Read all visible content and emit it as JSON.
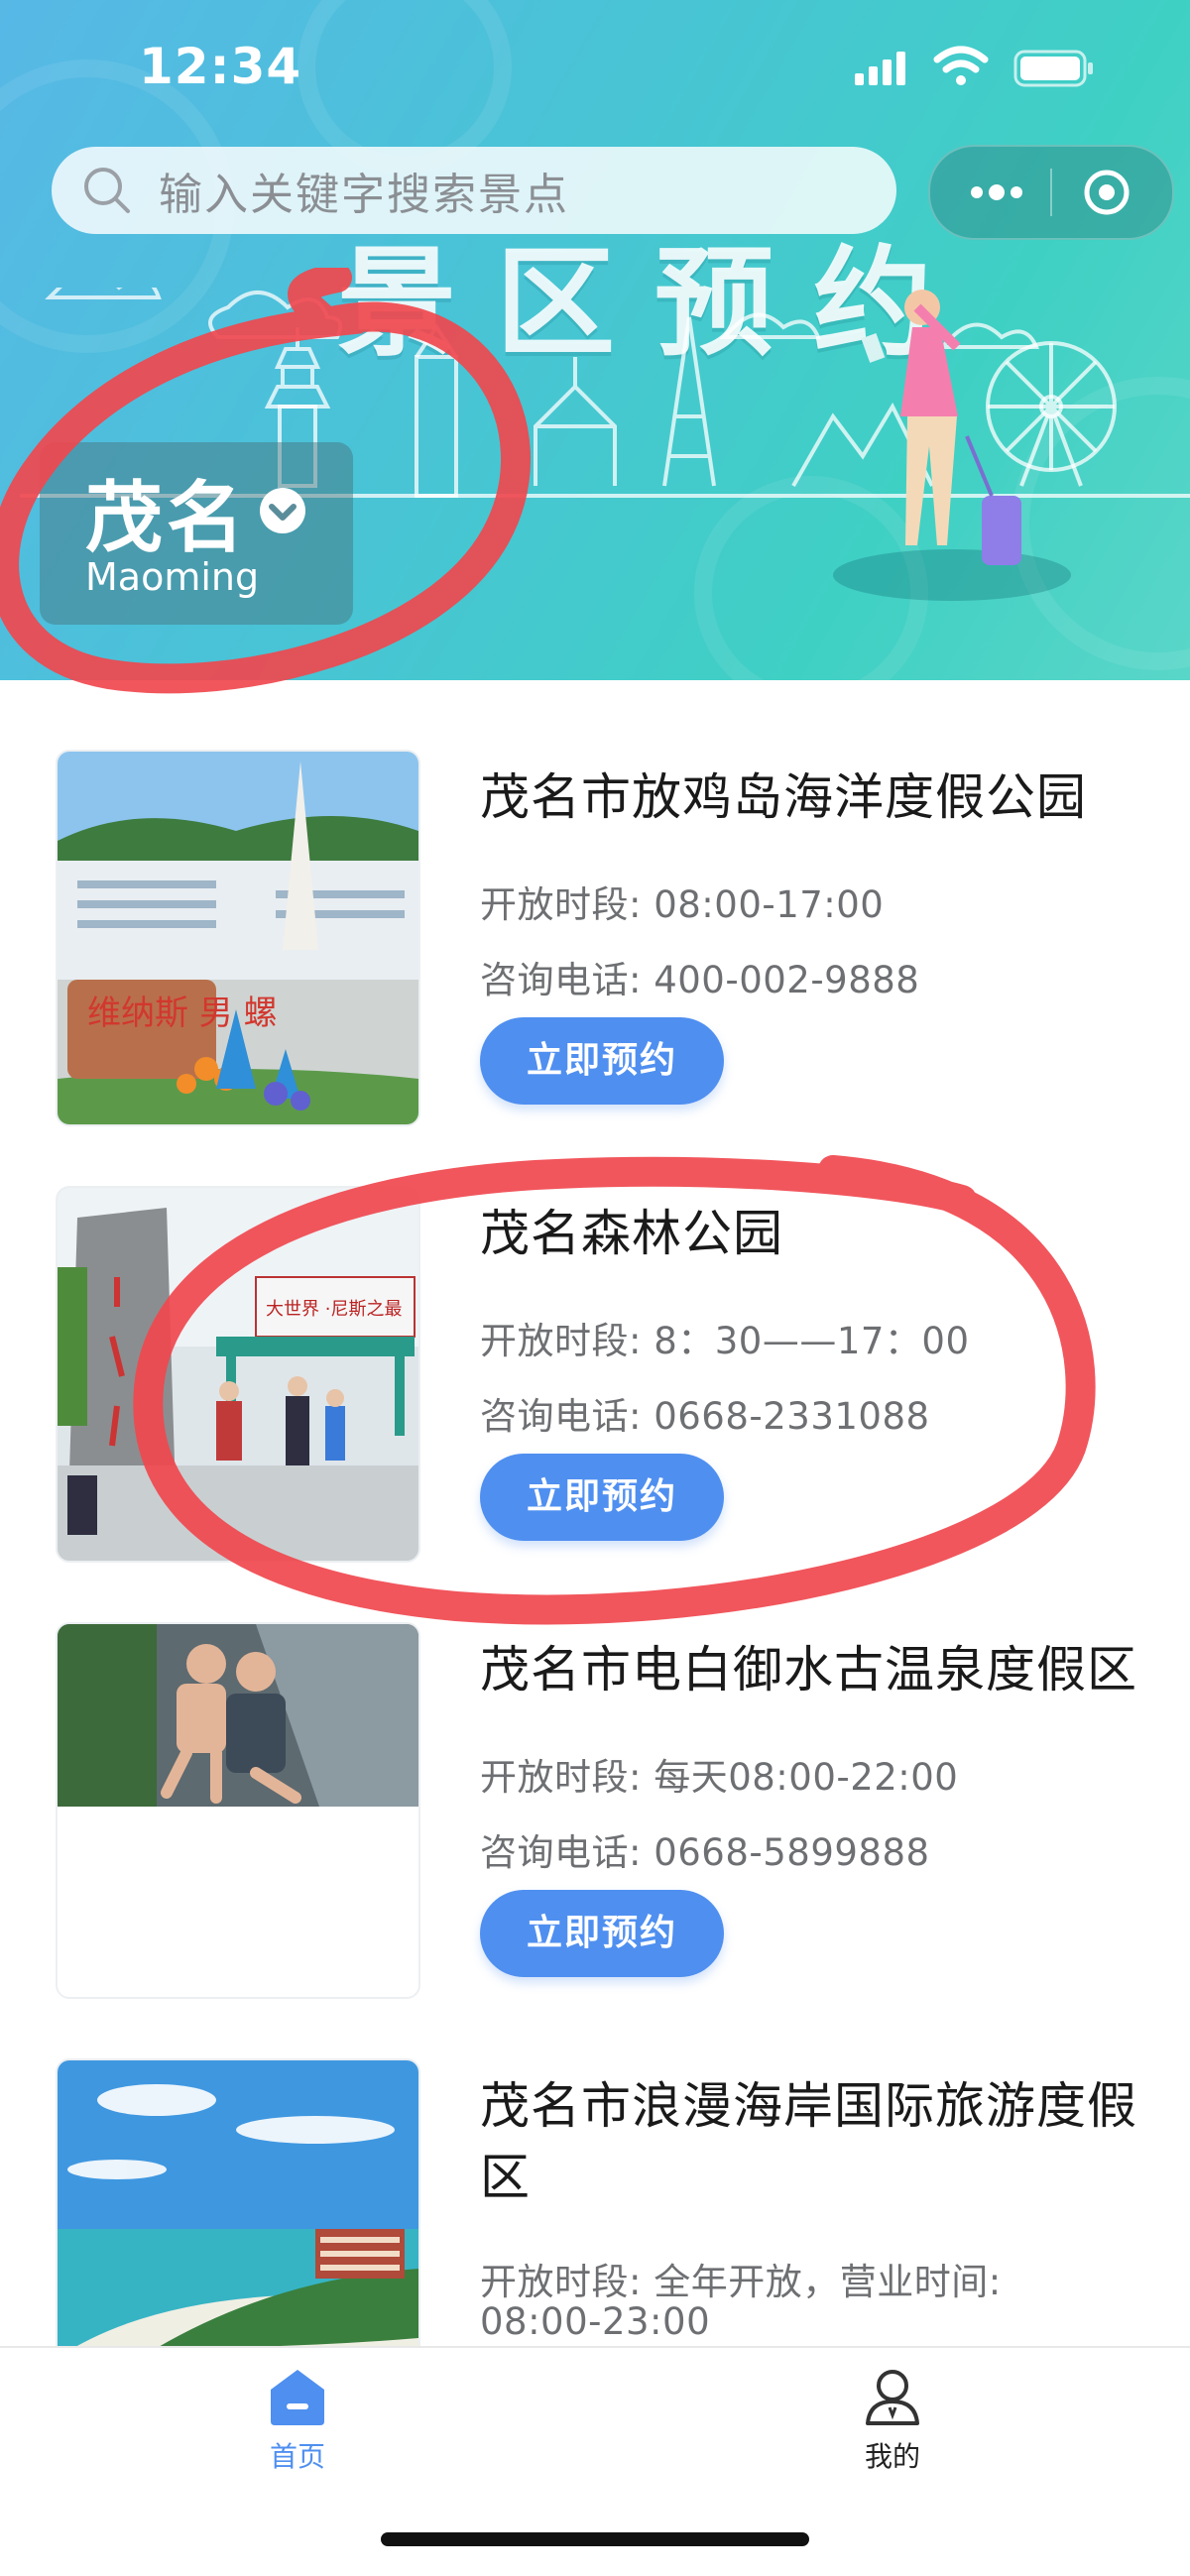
{
  "status_bar": {
    "time": "12:34"
  },
  "search": {
    "placeholder": "输入关键字搜索景点"
  },
  "banner": {
    "title": "景区预约"
  },
  "city": {
    "name": "茂名",
    "name_en": "Maoming"
  },
  "colors": {
    "accent": "#4f8ff0",
    "annotation": "#f0484e",
    "banner_start": "#57b8e6",
    "banner_end": "#3fd0c4"
  },
  "attractions": [
    {
      "name": "茂名市放鸡岛海洋度假公园",
      "hours": "开放时段: 08:00-17:00",
      "phone": "咨询电话: 400-002-9888",
      "book_label": "立即预约",
      "image_text": "维纳斯 男 螺"
    },
    {
      "name": "茂名森林公园",
      "hours": "开放时段: 8：30——17：00",
      "phone": "咨询电话: 0668-2331088",
      "book_label": "立即预约",
      "image_text": "大世界 ·尼斯之最"
    },
    {
      "name": "茂名市电白御水古温泉度假区",
      "hours": "开放时段: 每天08:00-22:00",
      "phone": "咨询电话: 0668-5899888",
      "book_label": "立即预约"
    },
    {
      "name": "茂名市浪漫海岸国际旅游度假区",
      "hours": "开放时段: 全年开放，营业时间: 08:00-23:00"
    }
  ],
  "tabbar": {
    "home_label": "首页",
    "mine_label": "我的"
  }
}
